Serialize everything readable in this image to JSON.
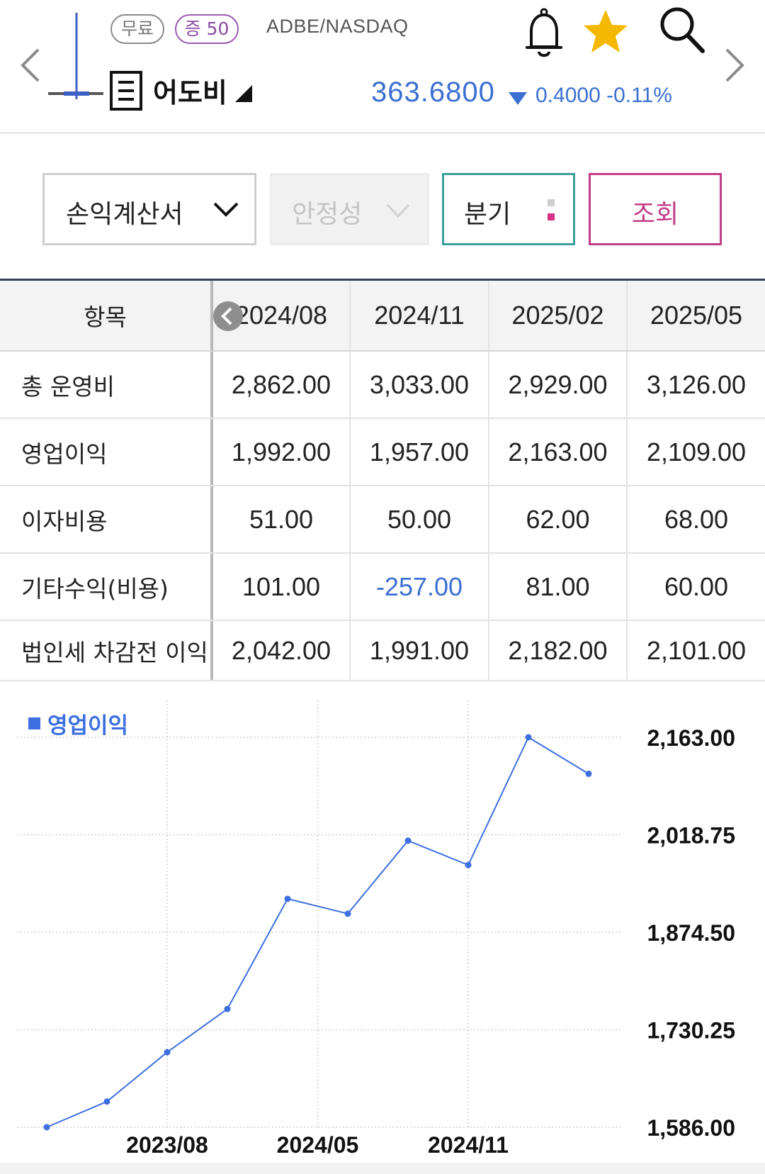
{
  "header": {
    "badge_free": "무료",
    "badge_margin": "증 50",
    "ticker": "ADBE/NASDAQ",
    "stock_name": "어도비",
    "price": "363.6800",
    "change": "0.4000 -0.11%",
    "colors": {
      "price": "#3b6fd1",
      "star": "#f5b800"
    }
  },
  "filters": {
    "statement": "손익계산서",
    "stability": "안정성",
    "period": "분기",
    "query_button": "조회"
  },
  "table": {
    "header_label": "항목",
    "columns": [
      "2024/08",
      "2024/11",
      "2025/02",
      "2025/05"
    ],
    "rows": [
      {
        "label": "총 운영비",
        "values": [
          "2,862.00",
          "3,033.00",
          "2,929.00",
          "3,126.00"
        ]
      },
      {
        "label": "영업이익",
        "values": [
          "1,992.00",
          "1,957.00",
          "2,163.00",
          "2,109.00"
        ]
      },
      {
        "label": "이자비용",
        "values": [
          "51.00",
          "50.00",
          "62.00",
          "68.00"
        ]
      },
      {
        "label": "기타수익(비용)",
        "values": [
          "101.00",
          "-257.00",
          "81.00",
          "60.00"
        ]
      },
      {
        "label": "법인세 차감전 이익",
        "values": [
          "2,042.00",
          "1,991.00",
          "2,182.00",
          "2,101.00"
        ]
      }
    ]
  },
  "chart_data": {
    "type": "line",
    "title": "",
    "xlabel": "",
    "ylabel": "",
    "series": [
      {
        "name": "영업이익",
        "color": "#3d6fe0",
        "values": [
          1586,
          1624,
          1697,
          1761,
          1924,
          1902,
          2010,
          1974,
          2163,
          2109
        ]
      }
    ],
    "x_tick_labels": [
      "2023/08",
      "2024/05",
      "2024/11"
    ],
    "x_tick_indices": [
      2,
      4.5,
      7
    ],
    "y_ticks": [
      "2,163.00",
      "2,018.75",
      "1,874.50",
      "1,730.25",
      "1,586.00"
    ],
    "ylim": [
      1586,
      2163
    ],
    "grid": true,
    "legend": "top-left"
  }
}
